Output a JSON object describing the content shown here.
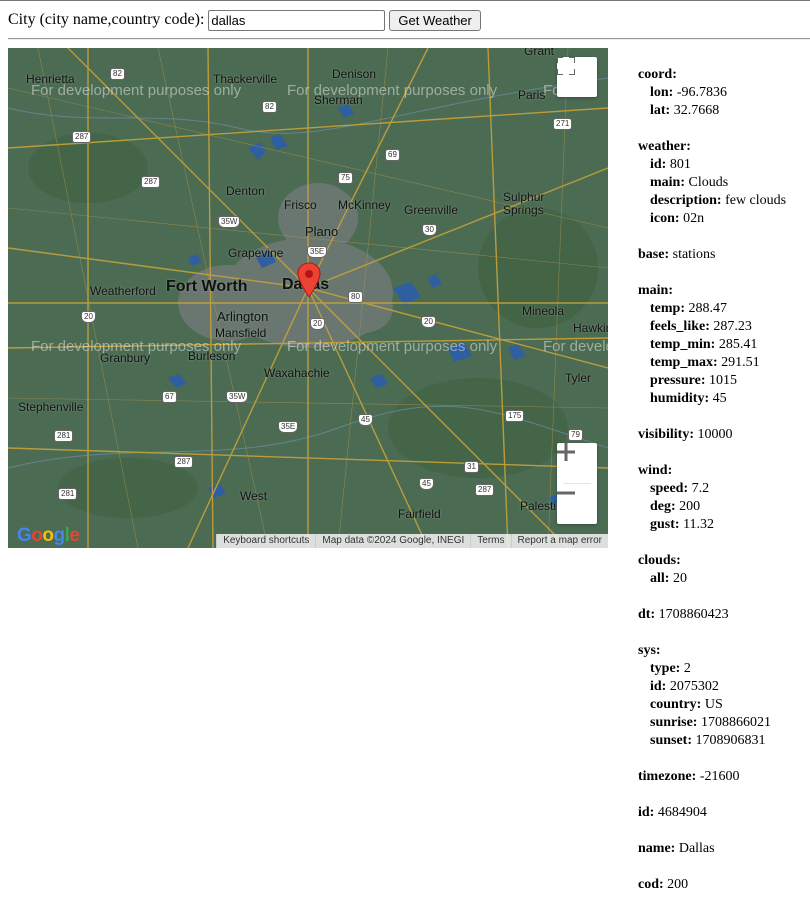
{
  "form": {
    "label": "City (city name,country code):",
    "input_value": "dallas",
    "button_label": "Get Weather"
  },
  "map": {
    "watermark": "For development purposes only",
    "watermark_partial": "For dev",
    "watermark_partial2": "For develo",
    "google_logo": "Google",
    "attribution": {
      "shortcuts": "Keyboard shortcuts",
      "data": "Map data ©2024 Google, INEGI",
      "terms": "Terms",
      "report": "Report a map error"
    },
    "cities": {
      "henrietta": "Henrietta",
      "thackerville": "Thackerville",
      "denison": "Denison",
      "sherman": "Sherman",
      "grant": "Grant",
      "paris": "Paris",
      "denton": "Denton",
      "frisco": "Frisco",
      "mckinney": "McKinney",
      "greenville": "Greenville",
      "sulphur_springs": "Sulphur\nSprings",
      "plano": "Plano",
      "grapevine": "Grapevine",
      "weatherford": "Weatherford",
      "fort_worth": "Fort Worth",
      "dallas": "Dallas",
      "arlington": "Arlington",
      "mansfield": "Mansfield",
      "mineola": "Mineola",
      "hawkins": "Hawkin",
      "granbury": "Granbury",
      "burleson": "Burleson",
      "waxahachie": "Waxahachie",
      "tyler": "Tyler",
      "stephenville": "Stephenville",
      "west": "West",
      "fairfield": "Fairfield",
      "palestine": "Palestine"
    },
    "shields": [
      "82",
      "287",
      "82",
      "69",
      "75",
      "271",
      "287",
      "35W",
      "35E",
      "30",
      "80",
      "20",
      "20",
      "20",
      "67",
      "35W",
      "35E",
      "45",
      "281",
      "287",
      "175",
      "31",
      "281",
      "287",
      "45",
      "79"
    ],
    "marker_color": "#ea4335"
  },
  "weather": {
    "coord": {
      "title": "coord:",
      "lon_k": "lon:",
      "lon": "-96.7836",
      "lat_k": "lat:",
      "lat": "32.7668"
    },
    "weather": {
      "title": "weather:",
      "id_k": "id:",
      "id": "801",
      "main_k": "main:",
      "main": "Clouds",
      "desc_k": "description:",
      "desc": "few clouds",
      "icon_k": "icon:",
      "icon": "02n"
    },
    "base": {
      "k": "base:",
      "v": "stations"
    },
    "main": {
      "title": "main:",
      "temp_k": "temp:",
      "temp": "288.47",
      "feels_k": "feels_like:",
      "feels": "287.23",
      "tmin_k": "temp_min:",
      "tmin": "285.41",
      "tmax_k": "temp_max:",
      "tmax": "291.51",
      "pressure_k": "pressure:",
      "pressure": "1015",
      "humidity_k": "humidity:",
      "humidity": "45"
    },
    "visibility": {
      "k": "visibility:",
      "v": "10000"
    },
    "wind": {
      "title": "wind:",
      "speed_k": "speed:",
      "speed": "7.2",
      "deg_k": "deg:",
      "deg": "200",
      "gust_k": "gust:",
      "gust": "11.32"
    },
    "clouds": {
      "title": "clouds:",
      "all_k": "all:",
      "all": "20"
    },
    "dt": {
      "k": "dt:",
      "v": "1708860423"
    },
    "sys": {
      "title": "sys:",
      "type_k": "type:",
      "type": "2",
      "id_k": "id:",
      "id": "2075302",
      "country_k": "country:",
      "country": "US",
      "sunrise_k": "sunrise:",
      "sunrise": "1708866021",
      "sunset_k": "sunset:",
      "sunset": "1708906831"
    },
    "timezone": {
      "k": "timezone:",
      "v": "-21600"
    },
    "id": {
      "k": "id:",
      "v": "4684904"
    },
    "name": {
      "k": "name:",
      "v": "Dallas"
    },
    "cod": {
      "k": "cod:",
      "v": "200"
    }
  }
}
